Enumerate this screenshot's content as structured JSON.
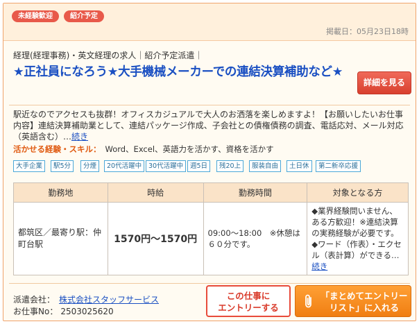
{
  "header": {
    "tags": [
      "未経験歓迎",
      "紹介予定"
    ],
    "posted_date": "掲載日：05月23日18時"
  },
  "job": {
    "category": "経理(経理事務)・英文経理の求人｜紹介予定派遣｜",
    "title": "★正社員になろう★大手機械メーカーでの連結決算補助など★",
    "detail_button": "詳細を見る",
    "description": "駅近なのでアクセスも抜群！オフィスカジュアルで大人のお洒落を楽しめますよ！【お願いしたいお仕事内容】連結決算補助業として、連結パッケージ作成、子会社との債権債務の調査、電話応対、メール対応（英語含む）…",
    "description_more": "続き",
    "skills_label": "活かせる経験・スキル：",
    "skills_value": "Word、Excel、英語力を活かす、資格を活かす",
    "feature_tags": [
      "大手企業",
      "駅5分",
      "分煙",
      "20代活躍中",
      "30代活躍中",
      "週5日",
      "残20上",
      "服装自由",
      "土日休",
      "第二新卒応援"
    ]
  },
  "table": {
    "headers": [
      "勤務地",
      "時給",
      "勤務時間",
      "対象となる方"
    ],
    "location": "都筑区／最寄り駅：仲町台駅",
    "wage": "1570円〜1570円",
    "hours": "09:00〜18:00　※休憩は６０分です。",
    "target": "◆業界経験問いません、ある方歓迎！※連結決算の実務経験が必要です。◆ワード（作表）・エクセル（表計算）ができる…",
    "target_more": "続き"
  },
  "footer": {
    "agency_label": "派遣会社：",
    "agency_name": "株式会社スタッフサービス",
    "job_number_label": "お仕事No：",
    "job_number": "2503025620",
    "entry_button_line1": "この仕事に",
    "entry_button_line2": "エントリーする",
    "bulk_button_line1": "「まとめてエントリー",
    "bulk_button_line2": "リスト」に入れる",
    "bulk_icon": "paperclip-icon"
  },
  "colors": {
    "accent_red": "#e8594a",
    "title_blue": "#1a4fc2",
    "skill_orange": "#e05a10",
    "tag_blue": "#4aa7d8",
    "bulk_orange": "#f07e12"
  }
}
